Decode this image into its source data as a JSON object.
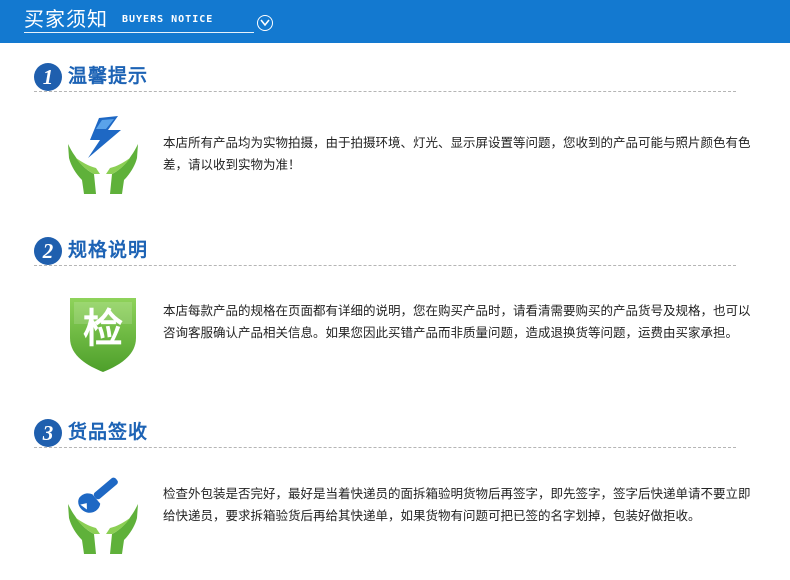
{
  "header": {
    "title": "买家须知",
    "subtitle": "BUYERS NOTICE"
  },
  "sections": [
    {
      "number": "1",
      "title": "温馨提示",
      "icon": "lightning-hands-icon",
      "text": "本店所有产品均为实物拍摄，由于拍摄环境、灯光、显示屏设置等问题，您收到的产品可能与照片颜色有色差，请以收到实物为准！"
    },
    {
      "number": "2",
      "title": "规格说明",
      "icon": "inspect-shield-icon",
      "icon_char": "检",
      "text": "本店每款产品的规格在页面都有详细的说明，您在购买产品时，请看清需要购买的产品货号及规格，也可以咨询客服确认产品相关信息。如果您因此买错产品而非质量问题，造成退换货等问题，运费由买家承担。"
    },
    {
      "number": "3",
      "title": "货品签收",
      "icon": "wrench-hands-icon",
      "text": "检查外包装是否完好，最好是当着快递员的面拆箱验明货物后再签字，即先签字，签字后快递单请不要立即给快递员，要求拆箱验货后再给其快递单，如果货物有问题可把已签的名字划掉，包装好做拒收。"
    }
  ],
  "colors": {
    "header_bg": "#1379d0",
    "accent_blue": "#1d63b5",
    "hands_green": "#5fb13a"
  }
}
